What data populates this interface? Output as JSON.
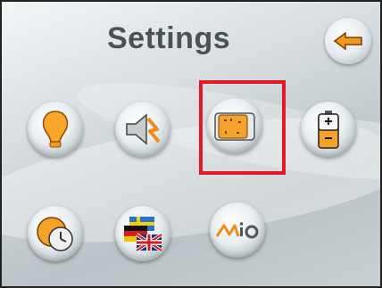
{
  "title": "Settings",
  "highlight_color": "#e01b22",
  "buttons": [
    {
      "name": "backlight-button",
      "icon": "light-bulb-icon"
    },
    {
      "name": "volume-button",
      "icon": "speaker-icon"
    },
    {
      "name": "screen-tap-button",
      "icon": "touch-screen-icon",
      "selected": true
    },
    {
      "name": "power-button",
      "icon": "battery-icon"
    },
    {
      "name": "date-time-button",
      "icon": "clock-globe-icon"
    },
    {
      "name": "language-button",
      "icon": "flags-icon"
    },
    {
      "name": "about-button",
      "icon": "mio-logo-icon"
    }
  ],
  "back_button": {
    "icon": "arrow-left-icon"
  }
}
